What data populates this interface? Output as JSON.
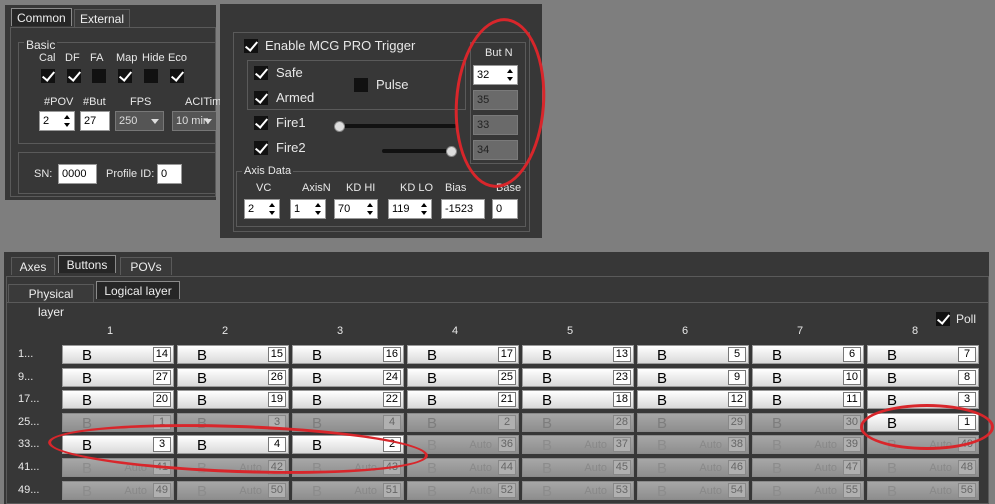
{
  "top_left": {
    "tabs": [
      {
        "label": "Common",
        "active": true
      },
      {
        "label": "External",
        "active": false
      }
    ],
    "group_basic": "Basic",
    "flags": [
      {
        "label": "Cal",
        "checked": true
      },
      {
        "label": "DF",
        "checked": true
      },
      {
        "label": "FA",
        "checked": false
      },
      {
        "label": "Map",
        "checked": true
      },
      {
        "label": "Hide",
        "checked": false
      },
      {
        "label": "Eco",
        "checked": true
      }
    ],
    "pov_label": "#POV",
    "but_label": "#But",
    "fps_label": "FPS",
    "acl_label": "ACITim",
    "pov_value": "2",
    "but_value": "27",
    "fps_value": "250",
    "acl_value": "10 min",
    "sn_label": "SN:",
    "sn_value": "0000",
    "profile_label": "Profile ID:",
    "profile_value": "0"
  },
  "mcg": {
    "enable_label": "Enable MCG PRO Trigger",
    "enable_checked": true,
    "safe_label": "Safe",
    "armed_label": "Armed",
    "fire1_label": "Fire1",
    "fire2_label": "Fire2",
    "pulse_label": "Pulse",
    "pulse_checked": false,
    "butn_label": "But N",
    "butn_values": [
      "32",
      "35",
      "33",
      "34"
    ],
    "fire1_level": 0.0,
    "fire2_level": 1.0,
    "axis_group": "Axis Data",
    "axis_headers": [
      "VC",
      "AxisN",
      "KD HI",
      "KD LO",
      "Bias",
      "Base"
    ],
    "axis_values": [
      "2",
      "1",
      "70",
      "119",
      "-1523",
      "0"
    ]
  },
  "buttons_panel": {
    "tabs": [
      {
        "label": "Axes",
        "active": false
      },
      {
        "label": "Buttons",
        "active": true
      },
      {
        "label": "POVs",
        "active": false
      }
    ],
    "subtabs": [
      {
        "label": "Physical layer",
        "active": false
      },
      {
        "label": "Logical layer",
        "active": true
      }
    ],
    "poll_label": "Poll",
    "poll_checked": true,
    "columns": [
      "1",
      "2",
      "3",
      "4",
      "5",
      "6",
      "7",
      "8"
    ],
    "rows": [
      {
        "label": "1...",
        "cells": [
          {
            "t": "B",
            "n": "14"
          },
          {
            "t": "B",
            "n": "15"
          },
          {
            "t": "B",
            "n": "16"
          },
          {
            "t": "B",
            "n": "17"
          },
          {
            "t": "B",
            "n": "13"
          },
          {
            "t": "B",
            "n": "5"
          },
          {
            "t": "B",
            "n": "6"
          },
          {
            "t": "B",
            "n": "7"
          }
        ]
      },
      {
        "label": "9...",
        "cells": [
          {
            "t": "B",
            "n": "27"
          },
          {
            "t": "B",
            "n": "26"
          },
          {
            "t": "B",
            "n": "24"
          },
          {
            "t": "B",
            "n": "25"
          },
          {
            "t": "B",
            "n": "23"
          },
          {
            "t": "B",
            "n": "9"
          },
          {
            "t": "B",
            "n": "10"
          },
          {
            "t": "B",
            "n": "8"
          }
        ]
      },
      {
        "label": "17...",
        "cells": [
          {
            "t": "B",
            "n": "20"
          },
          {
            "t": "B",
            "n": "19"
          },
          {
            "t": "B",
            "n": "22"
          },
          {
            "t": "B",
            "n": "21"
          },
          {
            "t": "B",
            "n": "18"
          },
          {
            "t": "B",
            "n": "12"
          },
          {
            "t": "B",
            "n": "11"
          },
          {
            "t": "B",
            "n": "3"
          }
        ]
      },
      {
        "label": "25...",
        "cells": [
          {
            "t": "B",
            "n": "1",
            "dim": true
          },
          {
            "t": "B",
            "n": "3",
            "dim": true
          },
          {
            "t": "B",
            "n": "4",
            "dim": true
          },
          {
            "t": "B",
            "n": "2",
            "dim": true
          },
          {
            "t": "B",
            "n": "28",
            "dim": true
          },
          {
            "t": "B",
            "n": "29",
            "dim": true
          },
          {
            "t": "B",
            "n": "30",
            "dim": true
          },
          {
            "t": "B",
            "n": "1"
          }
        ]
      },
      {
        "label": "33...",
        "cells": [
          {
            "t": "B",
            "n": "3"
          },
          {
            "t": "B",
            "n": "4"
          },
          {
            "t": "B",
            "n": "2"
          },
          {
            "t": "Auto",
            "n": "36",
            "dim": true
          },
          {
            "t": "Auto",
            "n": "37",
            "dim": true
          },
          {
            "t": "Auto",
            "n": "38",
            "dim": true
          },
          {
            "t": "Auto",
            "n": "39",
            "dim": true
          },
          {
            "t": "Auto",
            "n": "40",
            "dim": true
          }
        ]
      },
      {
        "label": "41...",
        "cells": [
          {
            "t": "Auto",
            "n": "41",
            "dim": true
          },
          {
            "t": "Auto",
            "n": "42",
            "dim": true
          },
          {
            "t": "Auto",
            "n": "43",
            "dim": true
          },
          {
            "t": "Auto",
            "n": "44",
            "dim": true
          },
          {
            "t": "Auto",
            "n": "45",
            "dim": true
          },
          {
            "t": "Auto",
            "n": "46",
            "dim": true
          },
          {
            "t": "Auto",
            "n": "47",
            "dim": true
          },
          {
            "t": "Auto",
            "n": "48",
            "dim": true
          }
        ]
      },
      {
        "label": "49...",
        "cells": [
          {
            "t": "Auto",
            "n": "49",
            "dim": true
          },
          {
            "t": "Auto",
            "n": "50",
            "dim": true
          },
          {
            "t": "Auto",
            "n": "51",
            "dim": true
          },
          {
            "t": "Auto",
            "n": "52",
            "dim": true
          },
          {
            "t": "Auto",
            "n": "53",
            "dim": true
          },
          {
            "t": "Auto",
            "n": "54",
            "dim": true
          },
          {
            "t": "Auto",
            "n": "55",
            "dim": true
          },
          {
            "t": "Auto",
            "n": "56",
            "dim": true
          }
        ]
      }
    ]
  },
  "annotation_color": "#d8262b"
}
